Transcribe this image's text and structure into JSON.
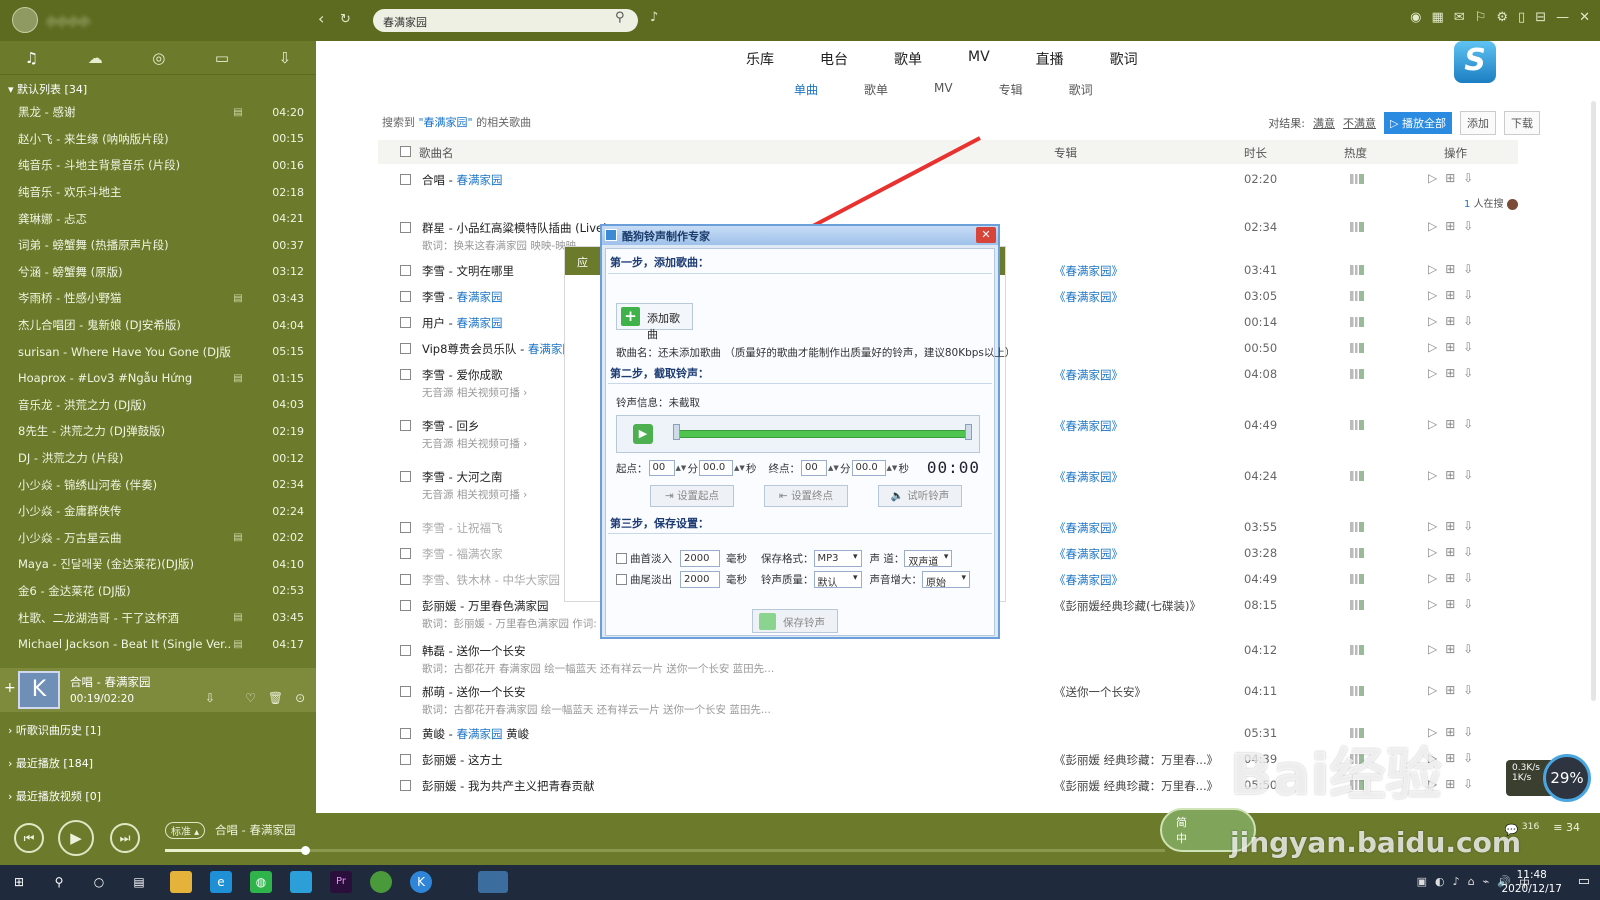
{
  "topbar": {
    "username": "小小小小",
    "search_value": "春满家园"
  },
  "sidebar": {
    "tabs": [
      "music-note-icon",
      "cloud-icon",
      "radio-icon",
      "mobile-icon",
      "download-icon"
    ],
    "playlist_header": "默认列表 [34]",
    "items": [
      {
        "name": "黑龙 - 感谢",
        "dur": "04:20",
        "mv": true
      },
      {
        "name": "赵小飞 - 来生缘 (呐呐版片段)",
        "dur": "00:15",
        "mv": false
      },
      {
        "name": "纯音乐 - 斗地主背景音乐 (片段)",
        "dur": "00:16",
        "mv": false
      },
      {
        "name": "纯音乐 - 欢乐斗地主",
        "dur": "02:18",
        "mv": false
      },
      {
        "name": "龚琳娜 - 忐忑",
        "dur": "04:21",
        "mv": false
      },
      {
        "name": "词弟 - 螃蟹舞 (热播原声片段)",
        "dur": "00:37",
        "mv": false
      },
      {
        "name": "兮涵 - 螃蟹舞 (原版)",
        "dur": "03:12",
        "mv": false
      },
      {
        "name": "岑雨桥 - 性感小野猫",
        "dur": "03:43",
        "mv": true
      },
      {
        "name": "杰儿合唱团 - 鬼新娘 (DJ安希版)",
        "dur": "04:04",
        "mv": false
      },
      {
        "name": "surisan - Where Have You Gone (DJ版)",
        "dur": "05:15",
        "mv": false
      },
      {
        "name": "Hoaprox - #Lov3 #Ngẫu Hứng",
        "dur": "01:15",
        "mv": true
      },
      {
        "name": "音乐龙 - 洪荒之力 (DJ版)",
        "dur": "04:03",
        "mv": false
      },
      {
        "name": "8先生 - 洪荒之力 (DJ弹鼓版)",
        "dur": "02:19",
        "mv": false
      },
      {
        "name": "DJ - 洪荒之力 (片段)",
        "dur": "00:12",
        "mv": false
      },
      {
        "name": "小少焱 - 锦绣山河卷 (伴奏)",
        "dur": "02:34",
        "mv": false
      },
      {
        "name": "小少焱 - 金庸群侠传",
        "dur": "02:24",
        "mv": false
      },
      {
        "name": "小少焱 - 万古星云曲",
        "dur": "02:02",
        "mv": true
      },
      {
        "name": "Maya - 진달래꽃 (金达莱花)(DJ版)",
        "dur": "04:10",
        "mv": false
      },
      {
        "name": "金6 - 金达莱花 (DJ版)",
        "dur": "02:53",
        "mv": false
      },
      {
        "name": "杜歌、二龙湖浩哥 - 干了这杯酒",
        "dur": "03:45",
        "mv": true
      },
      {
        "name": "Michael Jackson - Beat It (Single Ver...",
        "dur": "04:17",
        "mv": true
      }
    ],
    "now_playing": {
      "title": "合唱 - 春满家园",
      "time": "00:19/02:20"
    },
    "sections": [
      {
        "label": "听歌识曲历史 [1]"
      },
      {
        "label": "最近播放 [184]"
      },
      {
        "label": "最近播放视频 [0]"
      }
    ]
  },
  "main": {
    "tabs": [
      "乐库",
      "电台",
      "歌单",
      "MV",
      "直播",
      "歌词"
    ],
    "subtabs": [
      "单曲",
      "歌单",
      "MV",
      "专辑",
      "歌词"
    ],
    "result_prefix": "搜索到 ",
    "result_query": "\"春满家园\"",
    "result_suffix": " 的相关歌曲",
    "feedback_label": "对结果:",
    "satisfied": "满意",
    "unsatisfied": "不满意",
    "play_all": "▷ 播放全部",
    "add": "添加",
    "download": "下载",
    "columns": {
      "name": "歌曲名",
      "album": "专辑",
      "duration": "时长",
      "heat": "热度",
      "actions": "操作"
    },
    "rows": [
      {
        "a": "合唱 - ",
        "b": "春满家园",
        "c": "",
        "sub": "",
        "album": "",
        "dur": "02:20"
      },
      {
        "a": "群星 - 小品红高粱模特队插曲 (Live)",
        "b": "",
        "c": "",
        "sub": "歌词：换来这春满家园 映映-映映",
        "album": "",
        "dur": "02:34"
      },
      {
        "a": "李雪 - 文明在哪里",
        "b": "",
        "c": "",
        "sub": "",
        "album": "《春满家园》",
        "dur": "03:41"
      },
      {
        "a": "李雪 - ",
        "b": "春满家园",
        "c": "",
        "sub": "",
        "album": "《春满家园》",
        "dur": "03:05"
      },
      {
        "a": "用户 - ",
        "b": "春满家园",
        "c": "",
        "sub": "",
        "album": "",
        "dur": "00:14"
      },
      {
        "a": "Vip8尊贵会员乐队 - ",
        "b": "春满家园",
        "c": " (",
        "sub": "",
        "album": "",
        "dur": "00:50"
      },
      {
        "a": "李雪 - 爱你成歌",
        "b": "",
        "c": "",
        "sub": "无音源  相关视频可播 ›",
        "album": "《春满家园》",
        "dur": "04:08"
      },
      {
        "a": "李雪 - 回乡",
        "b": "",
        "c": "",
        "sub": "无音源  相关视频可播 ›",
        "album": "《春满家园》",
        "dur": "04:49"
      },
      {
        "a": "李雪 - 大河之南",
        "b": "",
        "c": "",
        "sub": "无音源  相关视频可播 ›",
        "album": "《春满家园》",
        "dur": "04:24"
      },
      {
        "a": "李雪 - 让祝福飞",
        "b": "",
        "c": "",
        "sub": "",
        "album": "《春满家园》",
        "dur": "03:55"
      },
      {
        "a": "李雪 - 福满农家",
        "b": "",
        "c": "",
        "sub": "",
        "album": "《春满家园》",
        "dur": "03:28"
      },
      {
        "a": "李雪、铁木林 - 中华大家园",
        "b": "",
        "c": "",
        "sub": "",
        "album": "《春满家园》",
        "dur": "04:49"
      },
      {
        "a": "彭丽媛 - 万里春色满家园",
        "b": "",
        "c": "",
        "sub": "歌词：彭丽媛 - 万里春色满家园 作词:",
        "album": "《彭丽媛经典珍藏(七碟装)》",
        "dur": "08:15"
      },
      {
        "a": "韩磊 - 送你一个长安",
        "b": "",
        "c": "",
        "sub": "歌词：古都花开 春满家园 绘一幅蓝天 还有祥云一片 送你一个长安 蓝田先...",
        "album": "",
        "dur": "04:12"
      },
      {
        "a": "郝萌 - 送你一个长安",
        "b": "",
        "c": "",
        "sub": "歌词：古都花开春满家园 绘一幅蓝天 还有祥云一片 送你一个长安 蓝田先...",
        "album": "《送你一个长安》",
        "dur": "04:11"
      },
      {
        "a": "黄峻 - ",
        "b": "春满家园",
        "c": " 黄峻",
        "sub": "",
        "album": "",
        "dur": "05:31"
      },
      {
        "a": "彭丽媛 - 这方土",
        "b": "",
        "c": "",
        "sub": "",
        "album": "《彭丽媛 经典珍藏：万里春...》",
        "dur": "04:39"
      },
      {
        "a": "彭丽媛 - 我为共产主义把青春贡献",
        "b": "",
        "c": "",
        "sub": "",
        "album": "《彭丽媛 经典珍藏：万里春...》",
        "dur": "05:50"
      }
    ],
    "searching_count": "1",
    "searching_label": "人在搜"
  },
  "dialog": {
    "title": "酷狗铃声制作专家",
    "step1": "第一步，添加歌曲：",
    "add_song": "添加歌曲",
    "song_name": "歌曲名：还未添加歌曲  （质量好的歌曲才能制作出质量好的铃声，建议80Kbps以上）",
    "step2": "第二步，截取铃声：",
    "ring_info": "铃声信息：未截取",
    "start_label": "起点：",
    "end_label": "终点：",
    "min_label": "分",
    "sec_label": "秒",
    "start_min": "00",
    "start_sec": "00.0",
    "end_min": "00",
    "end_sec": "00.0",
    "timer": "00:00",
    "set_start": "设置起点",
    "set_end": "设置终点",
    "preview": "试听铃声",
    "step3": "第三步，保存设置：",
    "fade_in": "曲首淡入",
    "fade_out": "曲尾淡出",
    "fade_in_val": "2000",
    "fade_out_val": "2000",
    "ms": "毫秒",
    "format_label": "保存格式：",
    "format_val": "MP3",
    "quality_label": "铃声质量：",
    "quality_val": "默认",
    "channel_label": "声    道：",
    "channel_val": "双声道",
    "boost_label": "声音增大：",
    "boost_val": "原始",
    "save": "保存铃声"
  },
  "overlay": {
    "title_prefix": "应"
  },
  "player": {
    "badge": "标准",
    "title": "合唱 - 春满家园",
    "right_count": "34",
    "right_small": "316",
    "progress": 0.14
  },
  "lang_pill": {
    "line1": "简",
    "line2": "中"
  },
  "net": {
    "up": "0.3K/s",
    "down": "1K/s",
    "cpu": "29%"
  },
  "taskbar": {
    "time": "11:48",
    "date": "2020/12/17",
    "ime": "中"
  },
  "watermark": {
    "line1": "Bai经验",
    "line2": "jingyan.baidu.com"
  },
  "colors": {
    "accent_green": "#6c7a2c",
    "link_blue": "#1a73c6",
    "dialog_border": "#6b9fd9",
    "arrow": "#e8322f"
  }
}
